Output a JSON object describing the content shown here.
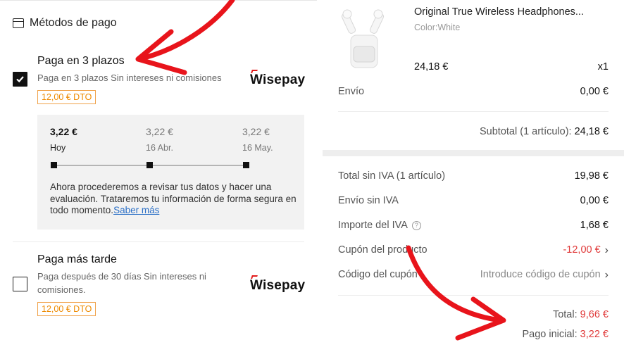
{
  "payment_methods": {
    "header": "Métodos de pago",
    "options": [
      {
        "title": "Paga en 3 plazos",
        "subtitle": "Paga en 3 plazos Sin intereses ni comisiones",
        "discount": "12,00 € DTO",
        "provider": "Wisepay",
        "checked": true
      },
      {
        "title": "Paga más tarde",
        "subtitle_line1": "Paga después de 30 días Sin intereses ni",
        "subtitle_line2": "comisiones.",
        "discount": "12,00 € DTO",
        "provider": "Wisepay",
        "checked": false
      }
    ],
    "plan": {
      "installments": [
        {
          "amount": "3,22 €",
          "date": "Hoy"
        },
        {
          "amount": "3,22 €",
          "date": "16 Abr."
        },
        {
          "amount": "3,22 €",
          "date": "16 May."
        }
      ],
      "note": "Ahora procederemos a revisar tus datos y hacer una evaluación. Trataremos tu información de forma segura en todo momento.",
      "link": "Saber más"
    }
  },
  "order": {
    "product": {
      "name": "Original True Wireless Headphones...",
      "color": "Color:White",
      "price": "24,18 €",
      "qty": "x1"
    },
    "shipping_label": "Envío",
    "shipping_value": "0,00 €",
    "subtotal_label": "Subtotal (1 artículo):",
    "subtotal_value": "24,18 €",
    "summary": [
      {
        "label": "Total sin IVA (1 artículo)",
        "value": "19,98 €"
      },
      {
        "label": "Envío sin IVA",
        "value": "0,00 €"
      },
      {
        "label": "Importe del IVA",
        "value": "1,68 €"
      },
      {
        "label": "Cupón del producto",
        "value": "-12,00 €"
      },
      {
        "label": "Código del cupón",
        "value": "Introduce código de cupón"
      }
    ],
    "total_label": "Total:",
    "total_value": "9,66 €",
    "initial_label": "Pago inicial:",
    "initial_value": "3,22 €"
  },
  "colors": {
    "accent_red": "#e03a3a",
    "discount_orange": "#ee8a00",
    "link_blue": "#2b6fc6",
    "annotation_red": "#e8141b"
  },
  "icons": [
    "card-icon",
    "check-icon",
    "help-icon",
    "chevron-right-icon",
    "wisepay-logo"
  ]
}
